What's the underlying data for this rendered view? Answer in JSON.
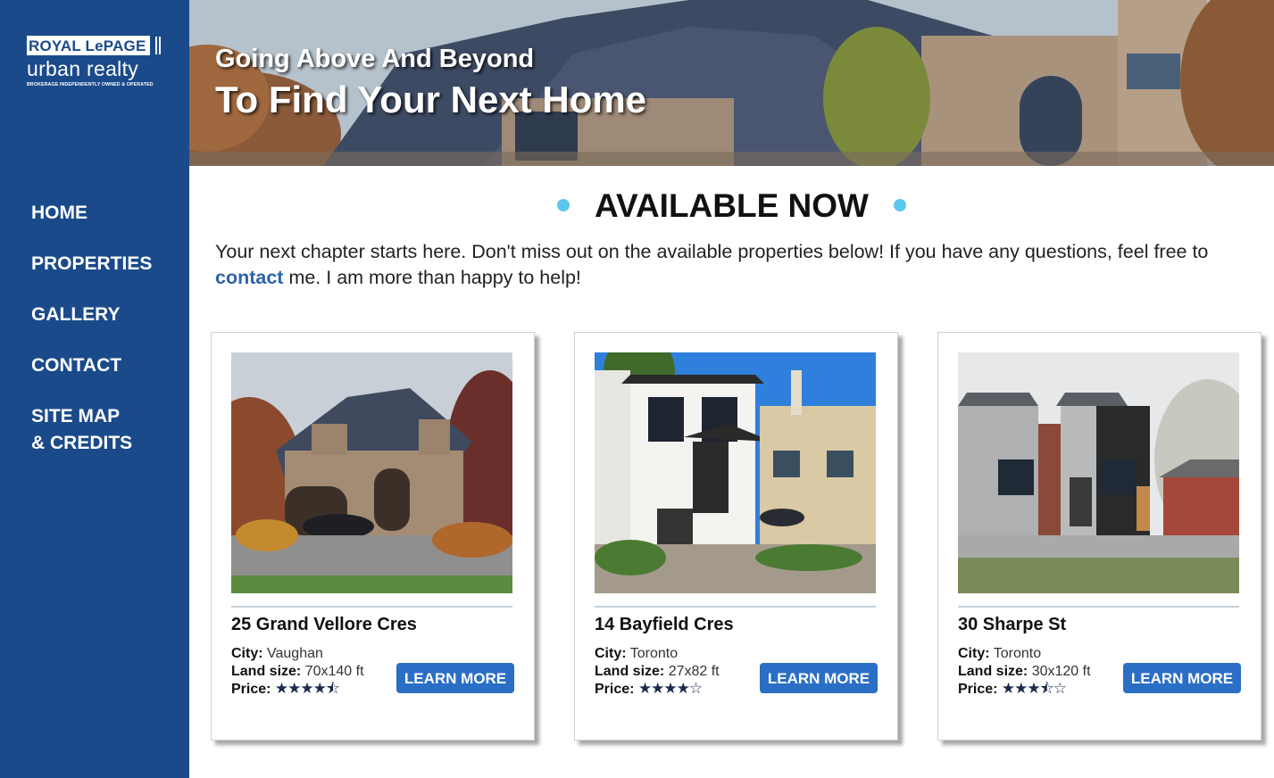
{
  "brand": {
    "name": "ROYAL LePAGE",
    "subname": "urban realty",
    "tagline": "BROKERAGE INDEPENDENTLY OWNED & OPERATED"
  },
  "nav": [
    {
      "label": "HOME"
    },
    {
      "label": "PROPERTIES"
    },
    {
      "label": "GALLERY"
    },
    {
      "label": "CONTACT"
    },
    {
      "label": "SITE MAP",
      "label2": "& CREDITS"
    }
  ],
  "hero": {
    "line1": "Going Above And Beyond",
    "line2": "To Find Your Next Home"
  },
  "main": {
    "title": "AVAILABLE NOW",
    "intro_before": "Your next chapter starts here. Don't miss out on the available properties below! If you have any questions, feel free to ",
    "intro_link": "contact",
    "intro_after": " me. I am more than happy to help!"
  },
  "labels": {
    "city": "City:",
    "land": "Land size:",
    "price": "Price:",
    "learn_more": "LEARN MORE"
  },
  "listings": [
    {
      "address": "25 Grand Vellore Cres",
      "city": "Vaughan",
      "land_size": "70x140 ft",
      "price_rating": 4.5,
      "stars": "★★★★⯪"
    },
    {
      "address": "14 Bayfield Cres",
      "city": "Toronto",
      "land_size": "27x82 ft",
      "price_rating": 4,
      "stars": "★★★★☆"
    },
    {
      "address": "30 Sharpe St",
      "city": "Toronto",
      "land_size": "30x120 ft",
      "price_rating": 3.5,
      "stars": "★★★⯪☆"
    }
  ],
  "colors": {
    "sidebar": "#1a4a8a",
    "accent_dot": "#5bc6ee",
    "button": "#2a6ec6",
    "link": "#2b64a8"
  }
}
